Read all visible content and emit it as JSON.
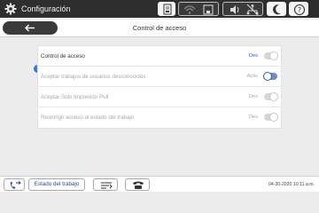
{
  "header": {
    "app_title": "Configuración",
    "icons": [
      "gear-icon",
      "document-status-icon",
      "wifi-icon",
      "ethernet-icon",
      "speaker-icon",
      "network-off-icon",
      "sleep-moon-icon",
      "help-icon"
    ]
  },
  "subheader": {
    "back_icon": "arrow-left-icon",
    "page_title": "Control de acceso"
  },
  "settings": [
    {
      "label": "Control de acceso",
      "value": "Des",
      "state": "off",
      "enabled": true,
      "value_color": "#2168c4"
    },
    {
      "label": "Aceptar trabajos de usuarios desconocidos",
      "value": "Activ",
      "state": "on",
      "enabled": false,
      "value_color": "#a8a8a8"
    },
    {
      "label": "Aceptar Solo Impresión Pull",
      "value": "Des",
      "state": "off",
      "enabled": false,
      "value_color": "#a8a8a8"
    },
    {
      "label": "Restringir acceso al estado del trabajo",
      "value": "Des",
      "state": "off",
      "enabled": false,
      "value_color": "#a8a8a8"
    }
  ],
  "info_badge": "i",
  "footer": {
    "job_status_label": "Estado del trabajo",
    "datetime": "04-30-2020 10:11 a.m.",
    "icons": [
      "phone-transfer-icon",
      "fax-icon",
      "phone-icon"
    ]
  },
  "colors": {
    "topbar_bg": "#2e2e2e",
    "accent_blue": "#2168c4",
    "info_blue": "#2b78d0"
  }
}
